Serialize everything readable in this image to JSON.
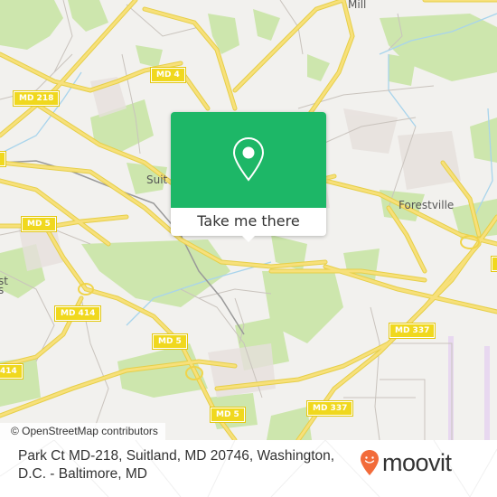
{
  "map": {
    "attribution": "© OpenStreetMap contributors",
    "colors": {
      "background": "#f2f1ee",
      "park": "#cde6ad",
      "road_major": "#f5dd5a",
      "road_minor": "#c9c3bd",
      "water": "#a8d4ec",
      "airfield": "#e8d8f0"
    },
    "places": [
      {
        "name": "Walker Mill",
        "label": "Mill"
      },
      {
        "name": "Suitland",
        "label": "Suit"
      },
      {
        "name": "Forestville",
        "label": "Forestville"
      },
      {
        "name": "District Heights",
        "label": "st\ns"
      }
    ],
    "shields": [
      {
        "id": "md-218",
        "label": "MD 218"
      },
      {
        "id": "md-4",
        "label": "MD 4"
      },
      {
        "id": "md-5-a",
        "label": "MD 5"
      },
      {
        "id": "md-5-b",
        "label": "MD 5"
      },
      {
        "id": "md-5-c",
        "label": "MD 5"
      },
      {
        "id": "md-414-a",
        "label": "MD 414"
      },
      {
        "id": "md-414-b",
        "label": "414"
      },
      {
        "id": "md-337-a",
        "label": "MD 337"
      },
      {
        "id": "md-337-b",
        "label": "MD 337"
      }
    ]
  },
  "popup": {
    "icon": "location-pin-icon",
    "button_label": "Take me there",
    "color": "#1db767"
  },
  "footer": {
    "address_line1": "Park Ct MD-218, Suitland, MD 20746, Washington,",
    "address_line2": "D.C. - Baltimore, MD",
    "brand": "moovit",
    "brand_color": "#f26b3a"
  }
}
